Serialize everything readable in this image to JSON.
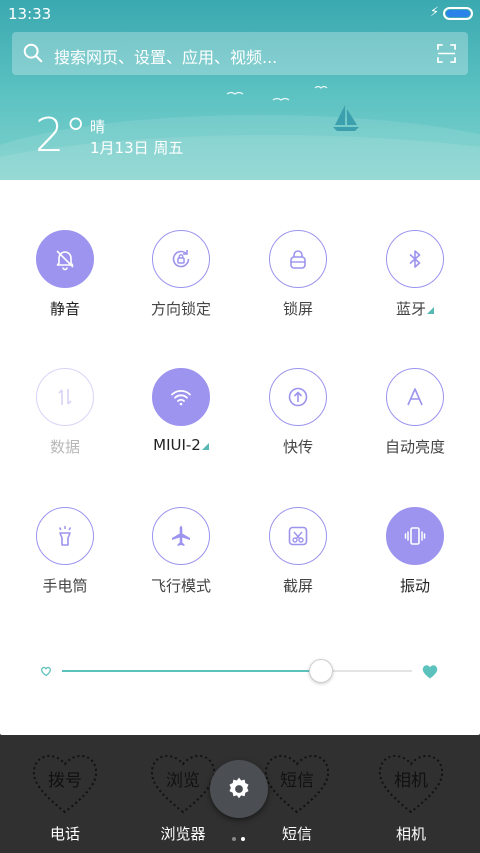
{
  "status_bar": {
    "time": "13:33"
  },
  "search": {
    "placeholder": "搜索网页、设置、应用、视频..."
  },
  "weather": {
    "temperature": "2°",
    "condition": "晴",
    "date": "1月13日 周五"
  },
  "tiles": [
    {
      "label": "静音",
      "icon": "silent-bell-icon",
      "state": "active"
    },
    {
      "label": "方向锁定",
      "icon": "rotation-lock-icon",
      "state": "inactive"
    },
    {
      "label": "锁屏",
      "icon": "lock-icon",
      "state": "inactive"
    },
    {
      "label": "蓝牙",
      "icon": "bluetooth-icon",
      "state": "inactive",
      "has_more": true
    },
    {
      "label": "数据",
      "icon": "data-arrows-icon",
      "state": "disabled"
    },
    {
      "label": "MIUI-2",
      "icon": "wifi-icon",
      "state": "active",
      "has_more": true
    },
    {
      "label": "快传",
      "icon": "upload-icon",
      "state": "inactive"
    },
    {
      "label": "自动亮度",
      "icon": "auto-brightness-icon",
      "state": "inactive"
    },
    {
      "label": "手电筒",
      "icon": "flashlight-icon",
      "state": "inactive"
    },
    {
      "label": "飞行模式",
      "icon": "airplane-icon",
      "state": "inactive"
    },
    {
      "label": "截屏",
      "icon": "screenshot-icon",
      "state": "inactive"
    },
    {
      "label": "振动",
      "icon": "vibrate-icon",
      "state": "active"
    }
  ],
  "brightness": {
    "level_fraction": 0.74
  },
  "dock": [
    {
      "label": "电话",
      "icon_text": "拨号"
    },
    {
      "label": "浏览器",
      "icon_text": "浏览"
    },
    {
      "label": "短信",
      "icon_text": "短信"
    },
    {
      "label": "相机",
      "icon_text": "相机"
    }
  ],
  "colors": {
    "accent": "#9c94ee",
    "teal": "#5cc2bd"
  }
}
